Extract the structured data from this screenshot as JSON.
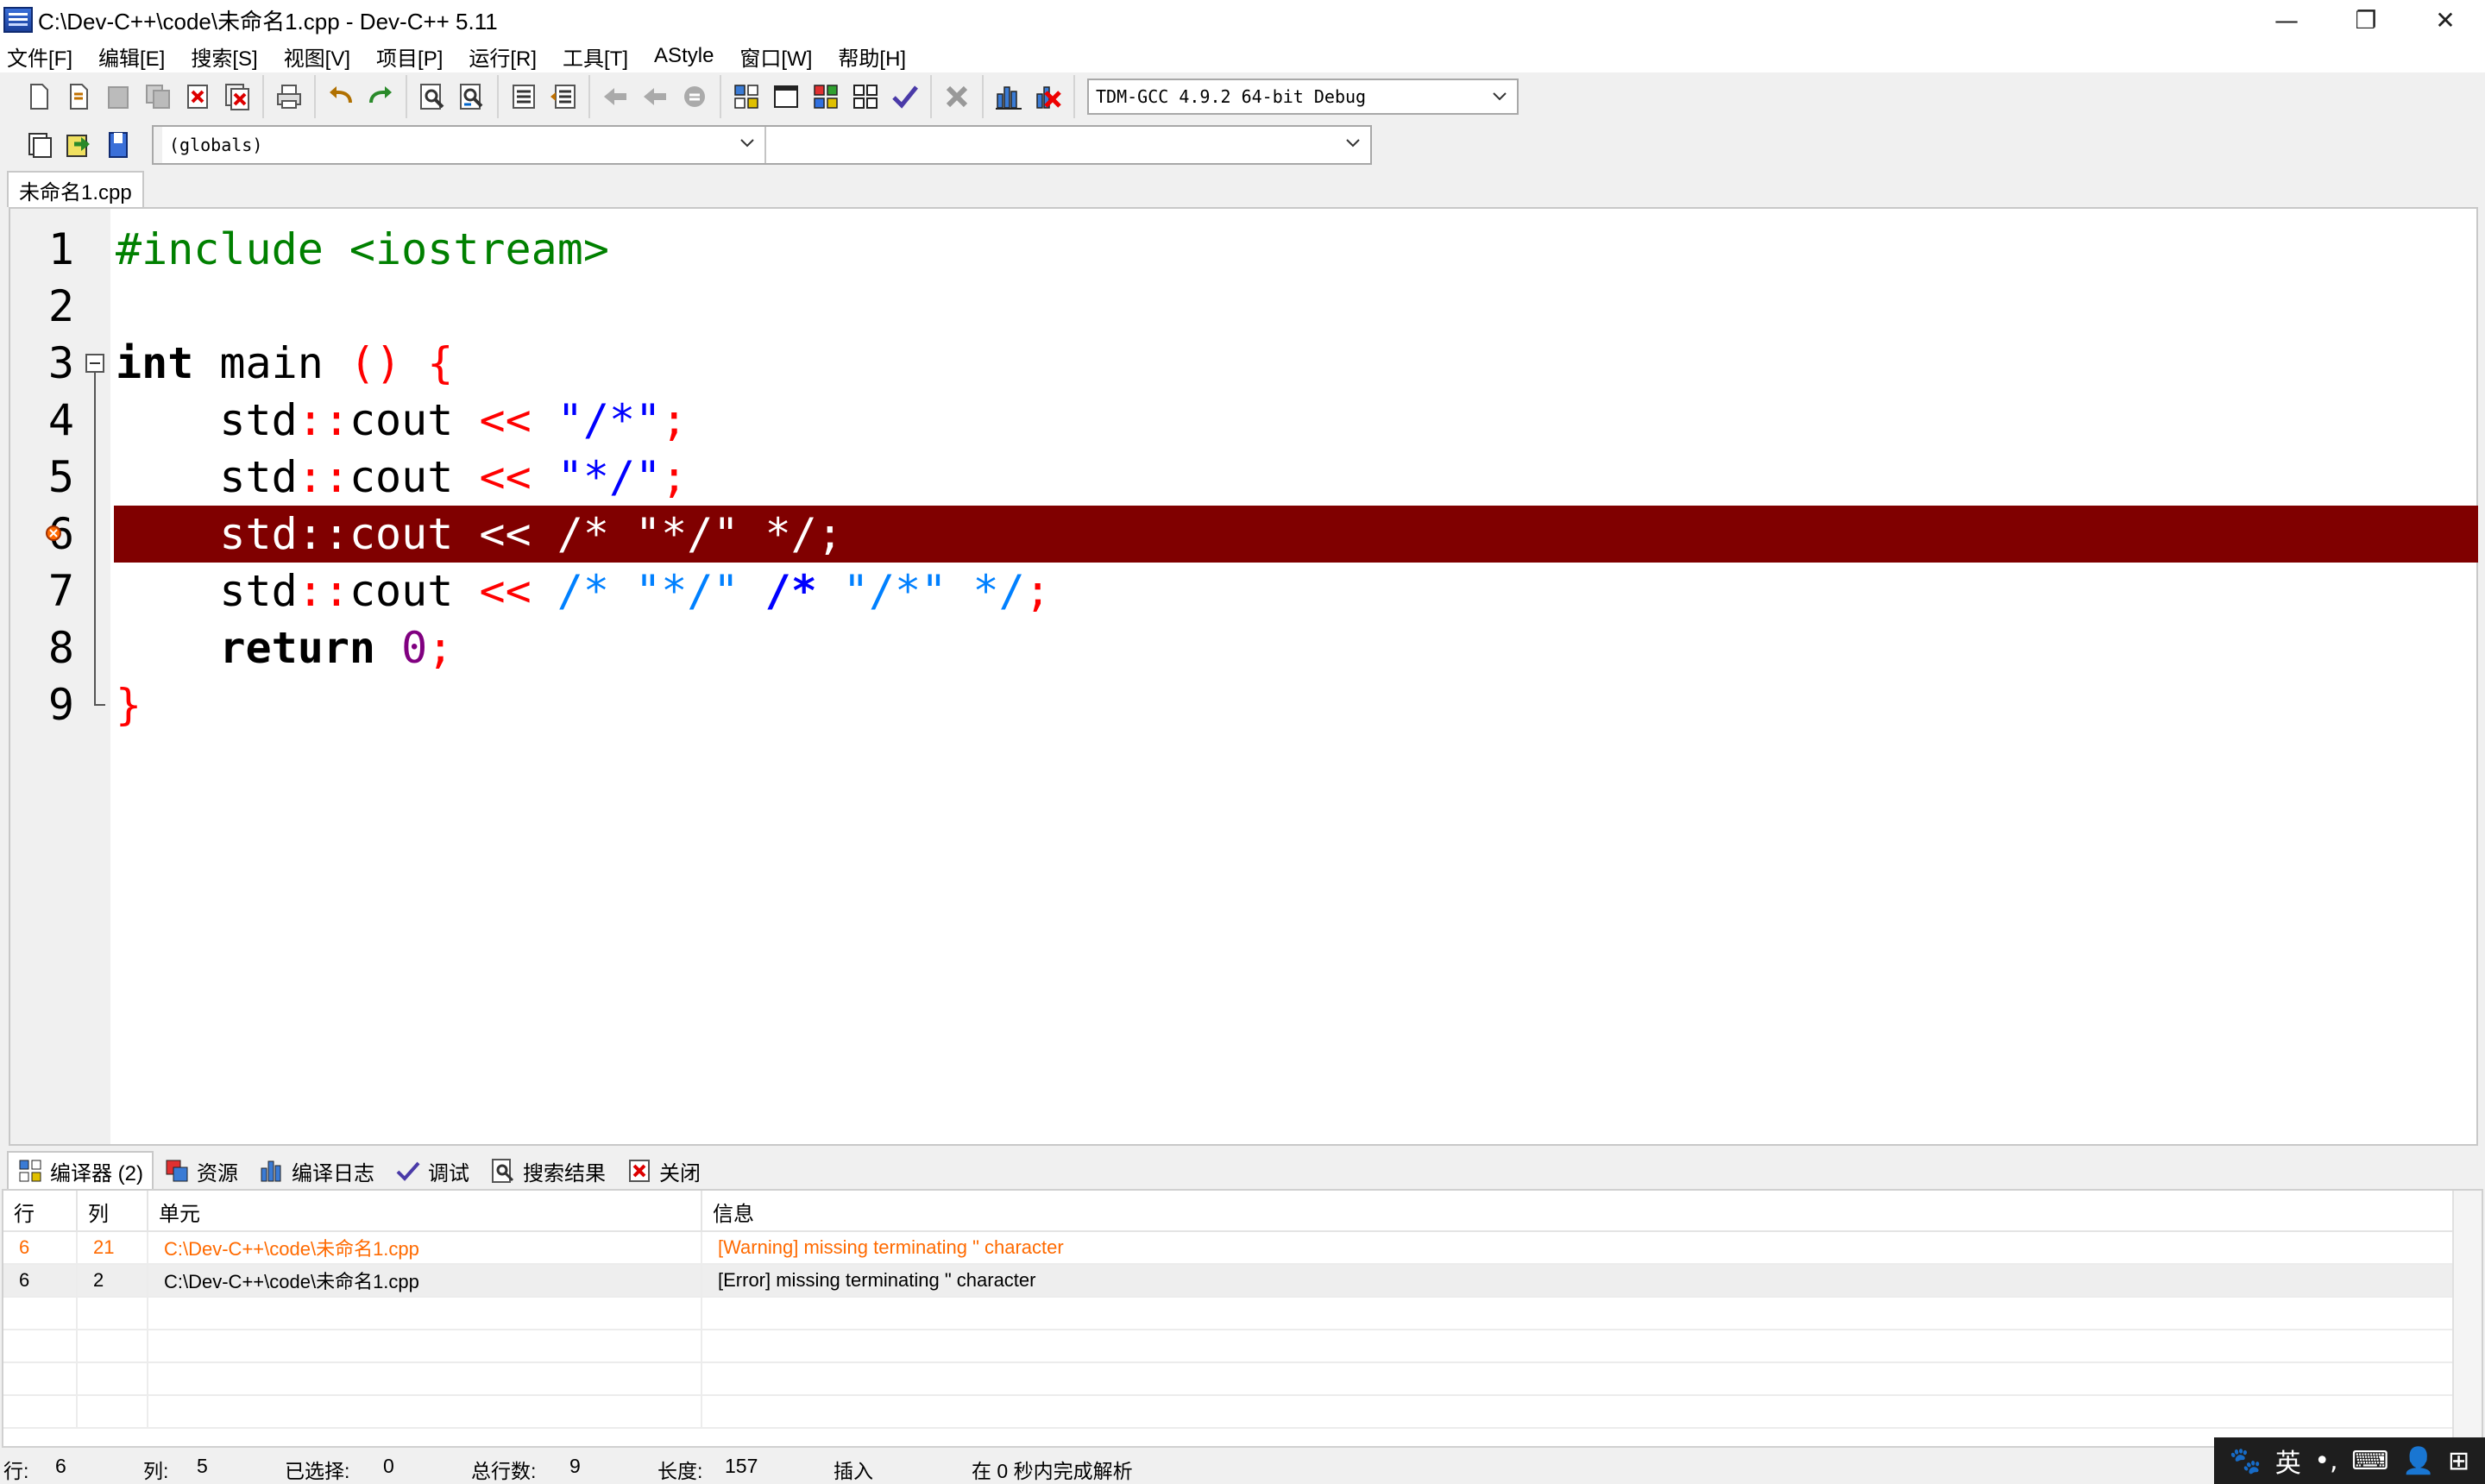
{
  "window": {
    "title": "C:\\Dev-C++\\code\\未命名1.cpp - Dev-C++ 5.11",
    "controls": {
      "minimize": "—",
      "restore": "❐",
      "close": "✕"
    }
  },
  "menu": [
    "文件[F]",
    "编辑[E]",
    "搜索[S]",
    "视图[V]",
    "项目[P]",
    "运行[R]",
    "工具[T]",
    "AStyle",
    "窗口[W]",
    "帮助[H]"
  ],
  "toolbar": {
    "compiler_select": "TDM-GCC 4.9.2 64-bit Debug",
    "class_select": "(globals)",
    "member_select": ""
  },
  "editor": {
    "tab": "未命名1.cpp",
    "line_numbers": [
      "1",
      "2",
      "3",
      "4",
      "5",
      "6",
      "7",
      "8",
      "9"
    ],
    "code": {
      "l1": {
        "pre": "#include <iostream>"
      },
      "l3": {
        "kw": "int",
        "name": " main ",
        "parens": "()",
        "brace": " {"
      },
      "l4": {
        "indent": "    ",
        "std": "std",
        "sep": "::",
        "cout": "cout",
        "op": " << ",
        "str": "\"/*\"",
        "semi": ";"
      },
      "l5": {
        "indent": "    ",
        "std": "std",
        "sep": "::",
        "cout": "cout",
        "op": " << ",
        "str": "\"*/\"",
        "semi": ";"
      },
      "l6": {
        "text": "    std::cout << /* \"*/\" */;"
      },
      "l7": {
        "indent": "    ",
        "std": "std",
        "sep": "::",
        "cout": "cout",
        "op": " << ",
        "c1": "/* ",
        "c2": "\"*/\"",
        "c3": " /*",
        "c4": " \"/*\"",
        "c5": " */",
        "semi": ";"
      },
      "l8": {
        "indent": "    ",
        "kw": "return",
        "num": " 0",
        "semi": ";"
      },
      "l9": {
        "brace": "}"
      }
    },
    "highlight_color": "#800000"
  },
  "panel": {
    "tabs": [
      "编译器 (2)",
      "资源",
      "编译日志",
      "调试",
      "搜索结果",
      "关闭"
    ],
    "columns": [
      "行",
      "列",
      "单元",
      "信息"
    ],
    "rows": [
      {
        "line": "6",
        "col": "21",
        "unit": "C:\\Dev-C++\\code\\未命名1.cpp",
        "message": "[Warning] missing terminating \" character",
        "kind": "warning"
      },
      {
        "line": "6",
        "col": "2",
        "unit": "C:\\Dev-C++\\code\\未命名1.cpp",
        "message": "[Error] missing terminating \" character",
        "kind": "error"
      }
    ],
    "warning_color": "#ff6a00"
  },
  "status": {
    "row_label": "行:",
    "row_value": "6",
    "col_label": "列:",
    "col_value": "5",
    "sel_label": "已选择:",
    "sel_value": "0",
    "total_label": "总行数:",
    "total_value": "9",
    "len_label": "长度:",
    "len_value": "157",
    "mode": "插入",
    "parse": "在 0 秒内完成解析"
  },
  "ime": {
    "paw": "🐾",
    "lang": "英",
    "punct": "•,",
    "keyboard": "⌨",
    "user": "👤",
    "grid": "⊞"
  }
}
